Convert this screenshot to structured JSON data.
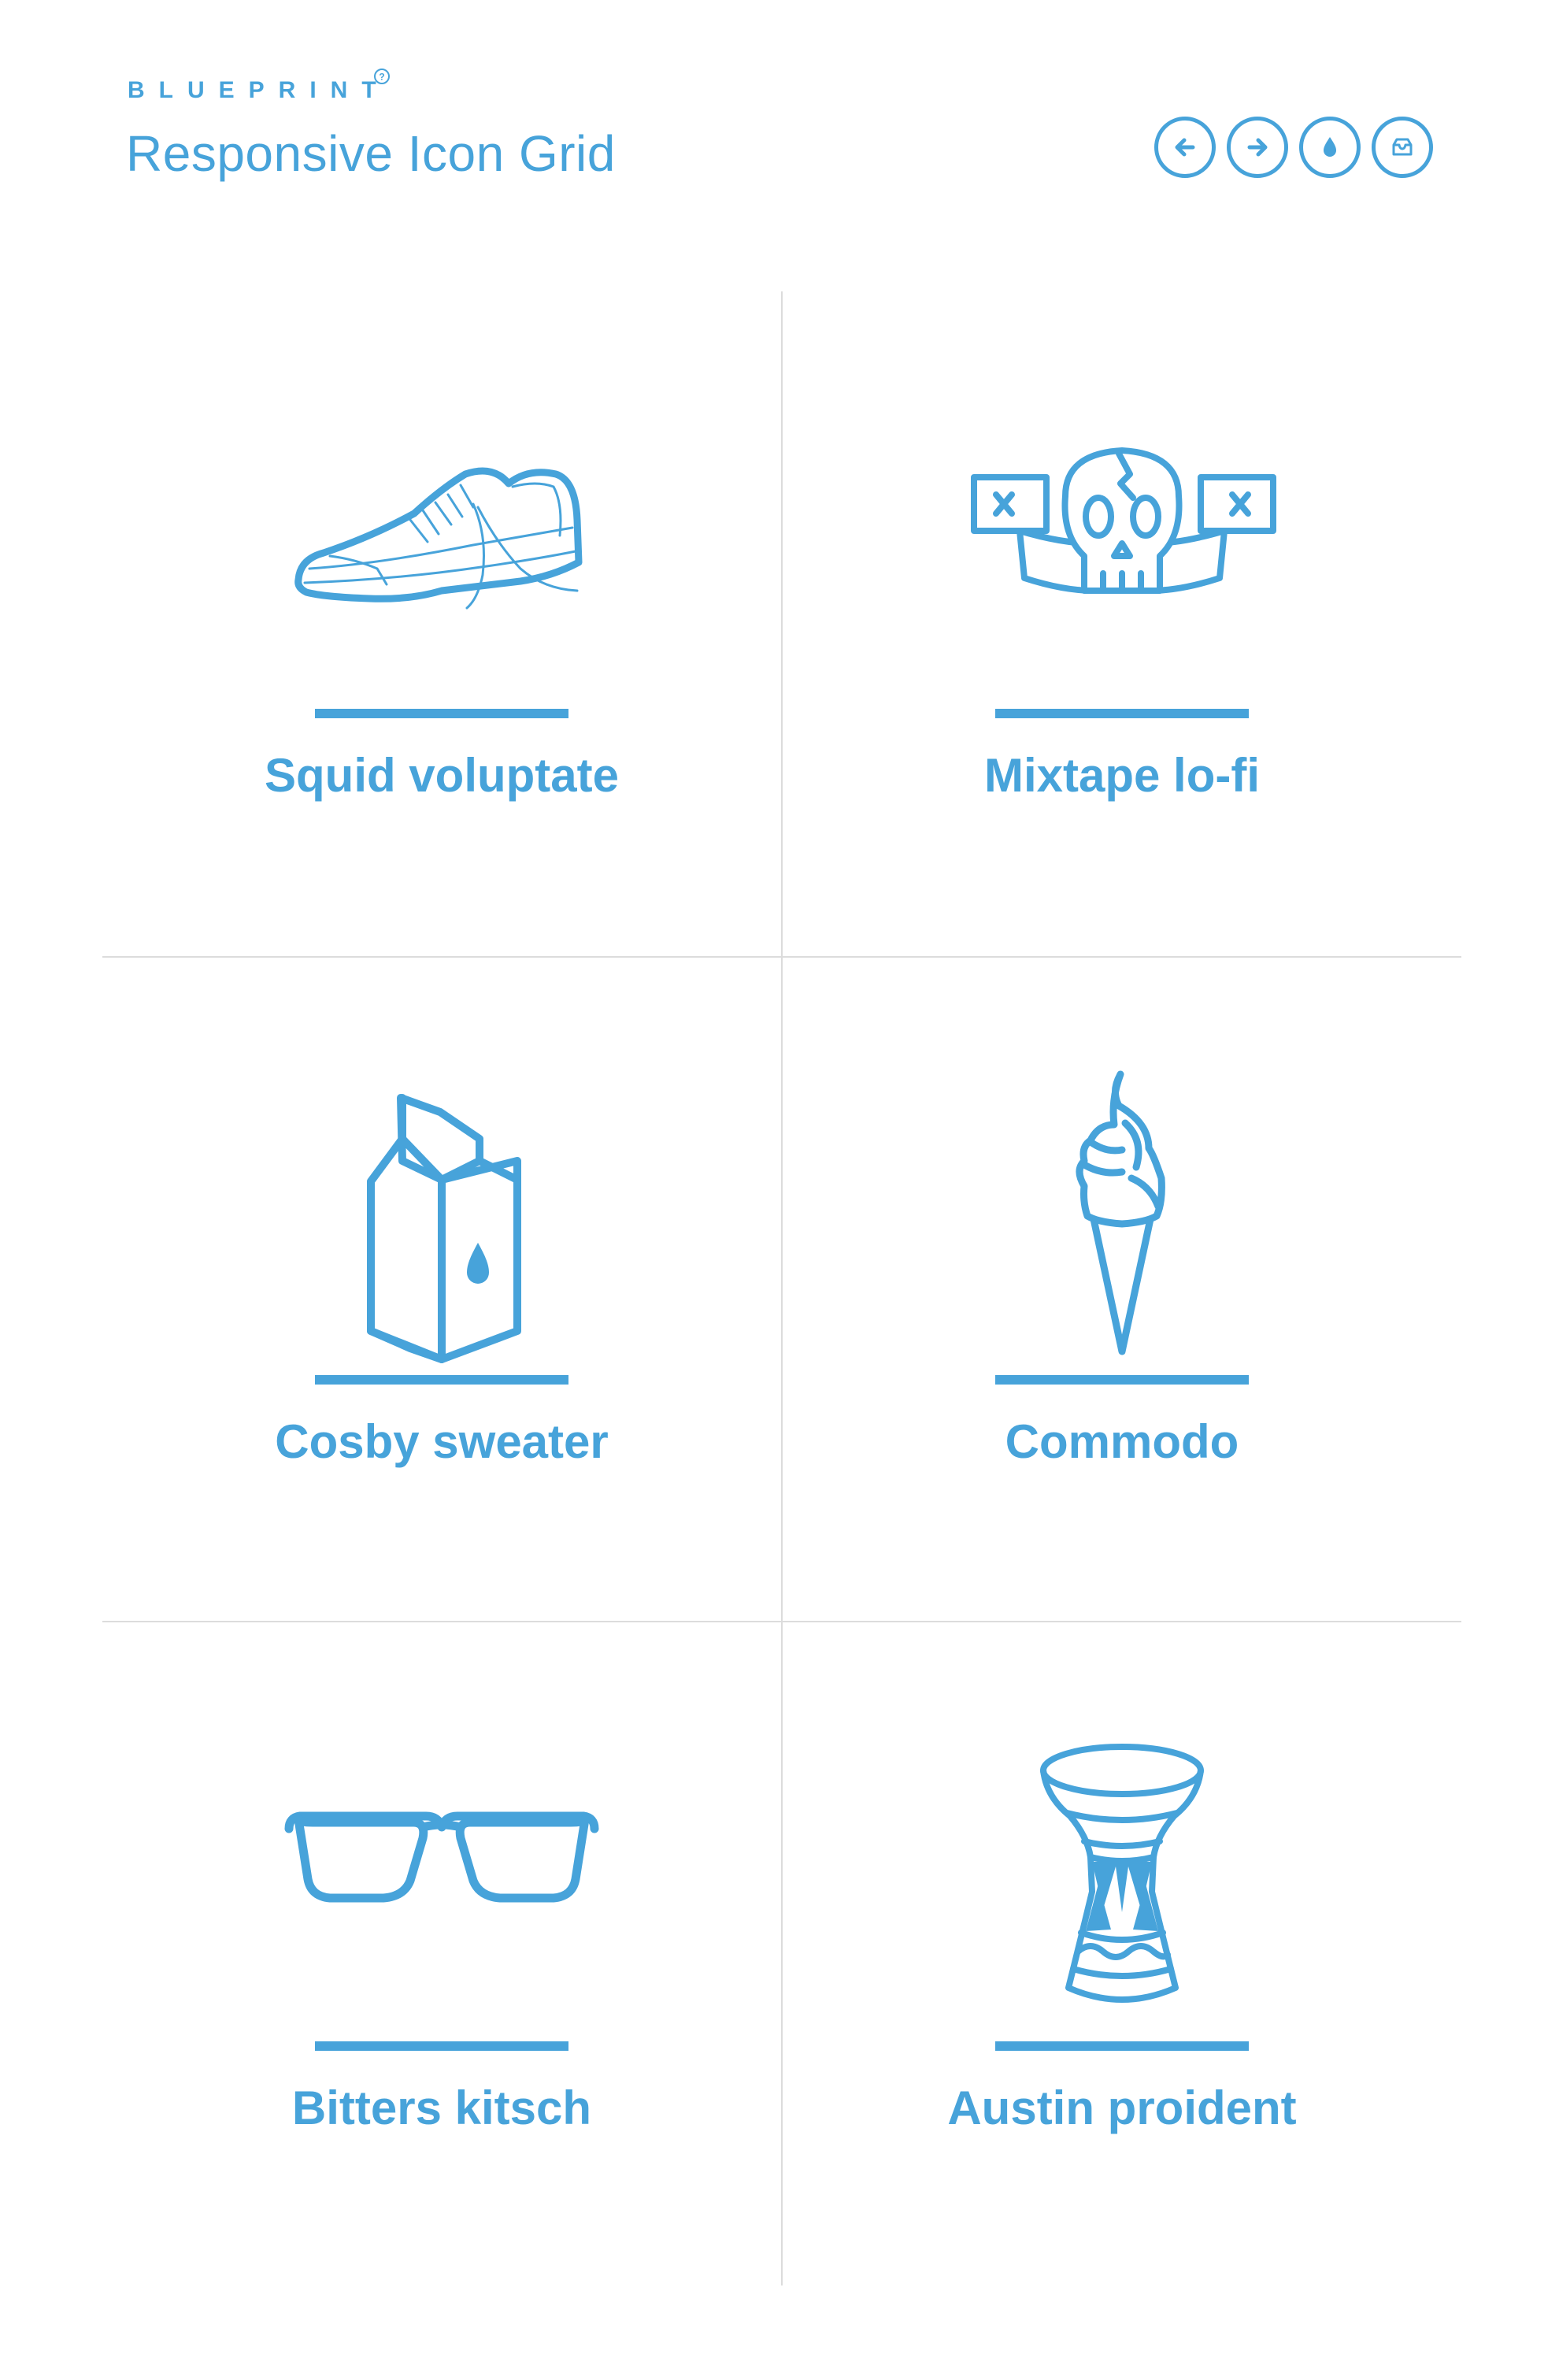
{
  "header": {
    "brand": "BLUEPRINT",
    "brand_mark": "?",
    "title": "Responsive Icon Grid",
    "nav": [
      {
        "name": "previous",
        "icon": "arrow-left-icon"
      },
      {
        "name": "next",
        "icon": "arrow-right-icon"
      },
      {
        "name": "drop",
        "icon": "drop-icon"
      },
      {
        "name": "archive",
        "icon": "inbox-icon"
      }
    ]
  },
  "colors": {
    "accent": "#47a3da",
    "divider": "#dcdcdc",
    "background": "#ffffff"
  },
  "grid": {
    "items": [
      {
        "label": "Squid voluptate",
        "icon": "sneaker-icon"
      },
      {
        "label": "Mixtape lo-fi",
        "icon": "skull-banner-icon"
      },
      {
        "label": "Cosby sweater",
        "icon": "milk-carton-icon"
      },
      {
        "label": "Commodo",
        "icon": "ice-cream-cone-icon"
      },
      {
        "label": "Bitters kitsch",
        "icon": "glasses-icon"
      },
      {
        "label": "Austin proident",
        "icon": "djembe-drum-icon"
      }
    ]
  }
}
